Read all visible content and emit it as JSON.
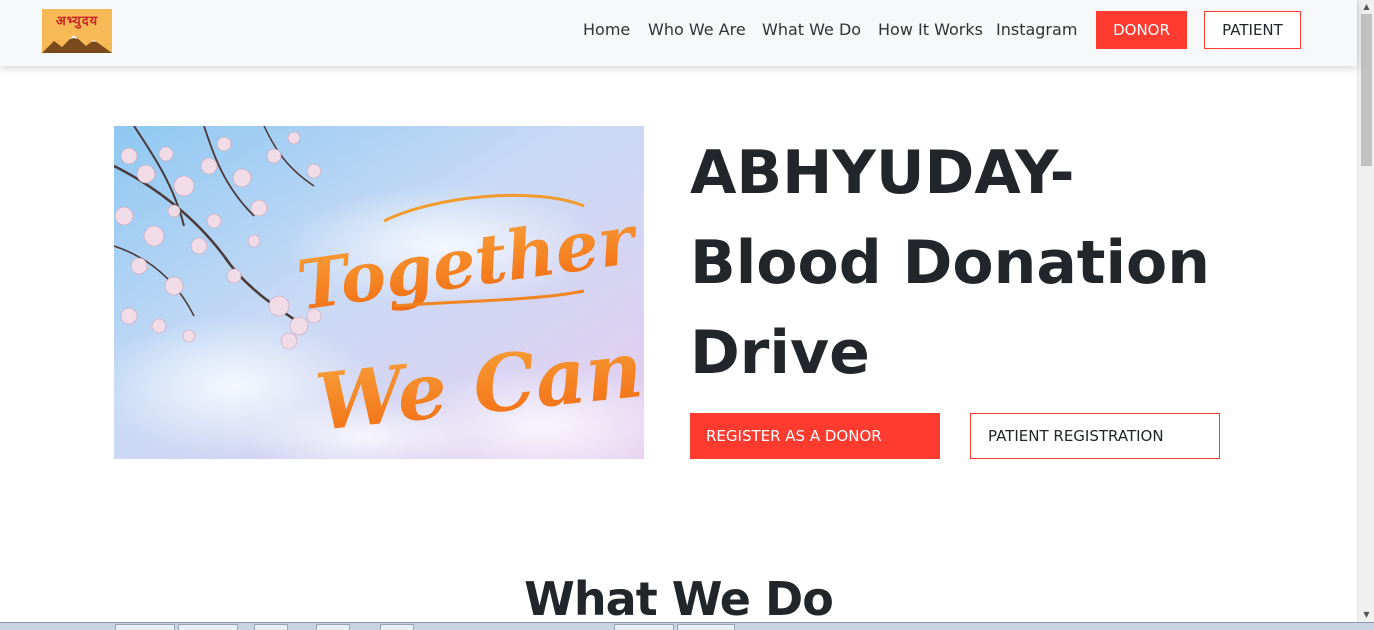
{
  "logo": {
    "text": "अभ्युदय"
  },
  "nav": {
    "links": [
      "Home",
      "Who We Are",
      "What We Do",
      "How It Works",
      "Instagram"
    ],
    "donor_label": "DONOR",
    "patient_label": "PATIENT"
  },
  "hero": {
    "image_text_line1": "Together",
    "image_text_line2": "We Can!",
    "title": "ABHYUDAY- Blood Donation Drive",
    "register_label": "REGISTER AS A DONOR",
    "patient_registration_label": "PATIENT REGISTRATION"
  },
  "section": {
    "title": "What We Do"
  },
  "colors": {
    "accent": "#ff3a2f",
    "navbar_bg": "#f7f8f9",
    "heading": "#22252a",
    "logo_bg": "#f7b955"
  },
  "icons": {
    "scroll_up": "scroll-up-arrow-icon",
    "scroll_down": "scroll-down-arrow-icon"
  }
}
